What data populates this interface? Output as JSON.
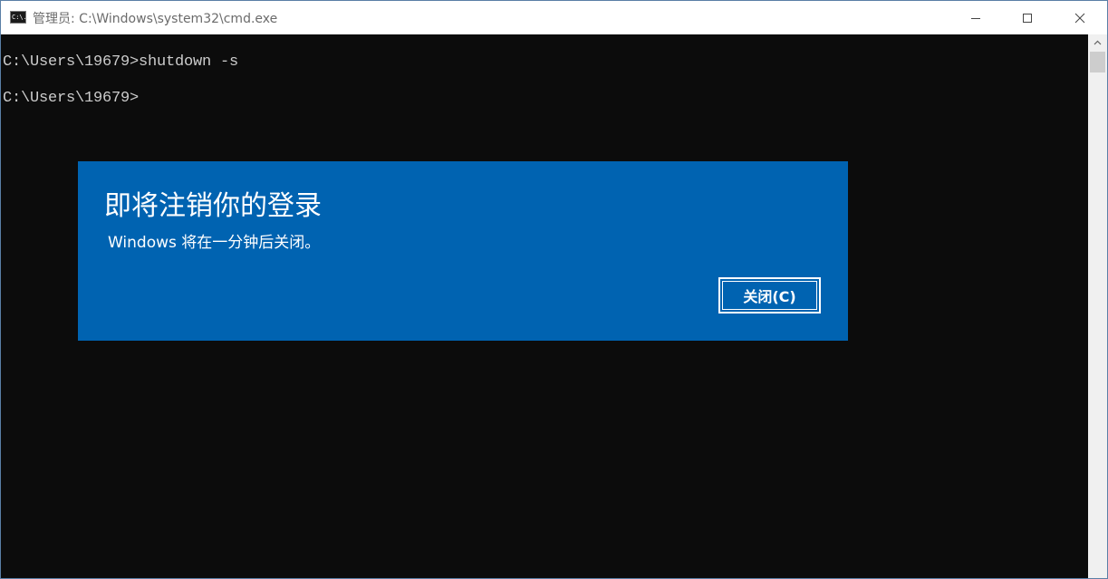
{
  "window": {
    "title": "管理员: C:\\Windows\\system32\\cmd.exe",
    "icon_text": "C:\\."
  },
  "console": {
    "lines": [
      "C:\\Users\\19679>shutdown -s",
      "C:\\Users\\19679>"
    ]
  },
  "dialog": {
    "title": "即将注销你的登录",
    "message": "Windows 将在一分钟后关闭。",
    "close_button_label": "关闭(C)"
  },
  "colors": {
    "dialog_background": "#0063b1",
    "console_background": "#0c0c0c",
    "console_text": "#cccccc"
  },
  "icons": {
    "minimize": "minimize-icon",
    "maximize": "maximize-icon",
    "close": "close-icon",
    "app": "cmd-icon",
    "scroll_up": "chevron-up-icon"
  }
}
